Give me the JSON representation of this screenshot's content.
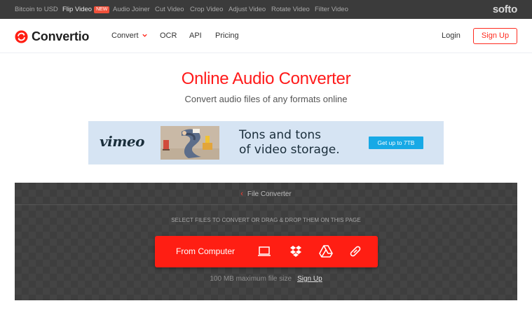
{
  "topbar": {
    "links": [
      {
        "label": "Bitcoin to USD"
      },
      {
        "label": "Flip Video",
        "badge": "NEW"
      },
      {
        "label": "Audio Joiner"
      },
      {
        "label": "Cut Video"
      },
      {
        "label": "Crop Video"
      },
      {
        "label": "Adjust Video"
      },
      {
        "label": "Rotate Video"
      },
      {
        "label": "Filter Video"
      }
    ],
    "brand": "softo"
  },
  "nav": {
    "logo_text": "Convertio",
    "items": [
      {
        "label": "Convert"
      },
      {
        "label": "OCR"
      },
      {
        "label": "API"
      },
      {
        "label": "Pricing"
      }
    ],
    "login": "Login",
    "signup": "Sign Up"
  },
  "hero": {
    "title": "Online Audio Converter",
    "subtitle": "Convert audio files of any formats online"
  },
  "ad": {
    "brand": "vimeo",
    "headline_line1": "Tons and tons",
    "headline_line2": "of video storage.",
    "cta": "Get up to 7TB"
  },
  "converter": {
    "breadcrumb": "File Converter",
    "hint": "SELECT FILES TO CONVERT OR DRAG & DROP THEM ON THIS PAGE",
    "from_computer": "From Computer",
    "sources": [
      "laptop-icon",
      "dropbox-icon",
      "google-drive-icon",
      "url-link-icon"
    ],
    "limit": "100 MB maximum file size",
    "signup_link": "Sign Up"
  },
  "colors": {
    "accent": "#ff1e13",
    "topbar_bg": "#3b3b3b",
    "panel_bg": "#3e3e3e",
    "ad_bg": "#d6e4f3",
    "ad_cta": "#17a9e6"
  }
}
